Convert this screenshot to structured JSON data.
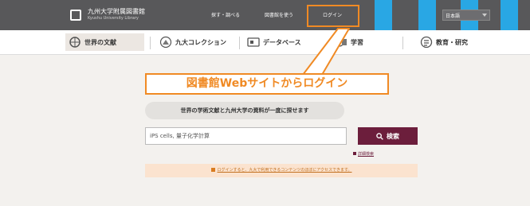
{
  "header": {
    "logo_name": "九州大学附属図書館",
    "logo_sub": "Kyushu University Library",
    "nav": [
      "探す・調べる",
      "図書館を使う",
      "ログイン"
    ],
    "language": "日本語"
  },
  "tabs": [
    {
      "label": "世界の文献",
      "icon": "globe-book-icon"
    },
    {
      "label": "九大コレクション",
      "icon": "collection-icon"
    },
    {
      "label": "データベース",
      "icon": "database-icon"
    },
    {
      "label": "学習",
      "icon": "study-icon"
    },
    {
      "label": "教育・研究",
      "icon": "research-icon"
    }
  ],
  "callout": "図書館Webサイトからログイン",
  "search": {
    "heading": "世界の学術文献と九州大学の資料が一度に探せます",
    "value": "iPS cells, 量子化学計算",
    "button_label": "検索",
    "advanced_label": "詳細検索"
  },
  "notice": "ログインすると、九大で利用できるコンテンツのほぼにアクセスできます。",
  "colors": {
    "accent": "#f08a24",
    "brand": "#6c1e3c",
    "topbar": "#58585a",
    "stripe": "#29a7e4"
  }
}
